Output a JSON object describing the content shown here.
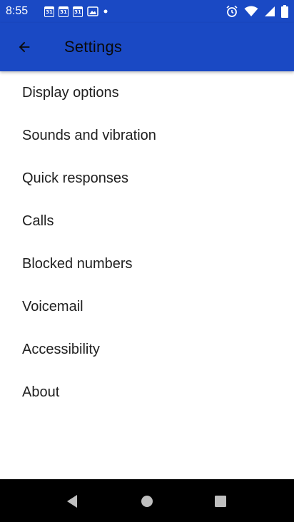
{
  "status_bar": {
    "time": "8:55",
    "calendar_icons": [
      "31",
      "31",
      "31"
    ],
    "icons_left": [
      "calendar-icon",
      "calendar-icon",
      "calendar-icon",
      "mountain-icon",
      "dot-icon"
    ],
    "icons_right": [
      "alarm-icon",
      "wifi-icon",
      "signal-icon",
      "battery-icon"
    ]
  },
  "app_bar": {
    "title": "Settings",
    "back_icon": "arrow-back-icon"
  },
  "settings": {
    "items": [
      {
        "label": "Display options"
      },
      {
        "label": "Sounds and vibration"
      },
      {
        "label": "Quick responses"
      },
      {
        "label": "Calls"
      },
      {
        "label": "Blocked numbers"
      },
      {
        "label": "Voicemail"
      },
      {
        "label": "Accessibility"
      },
      {
        "label": "About"
      }
    ]
  },
  "nav_bar": {
    "buttons": [
      "back-triangle-icon",
      "home-circle-icon",
      "recents-square-icon"
    ]
  },
  "colors": {
    "accent": "#1a49c4",
    "background": "#ffffff",
    "text": "#202020",
    "nav_bar": "#000000"
  }
}
